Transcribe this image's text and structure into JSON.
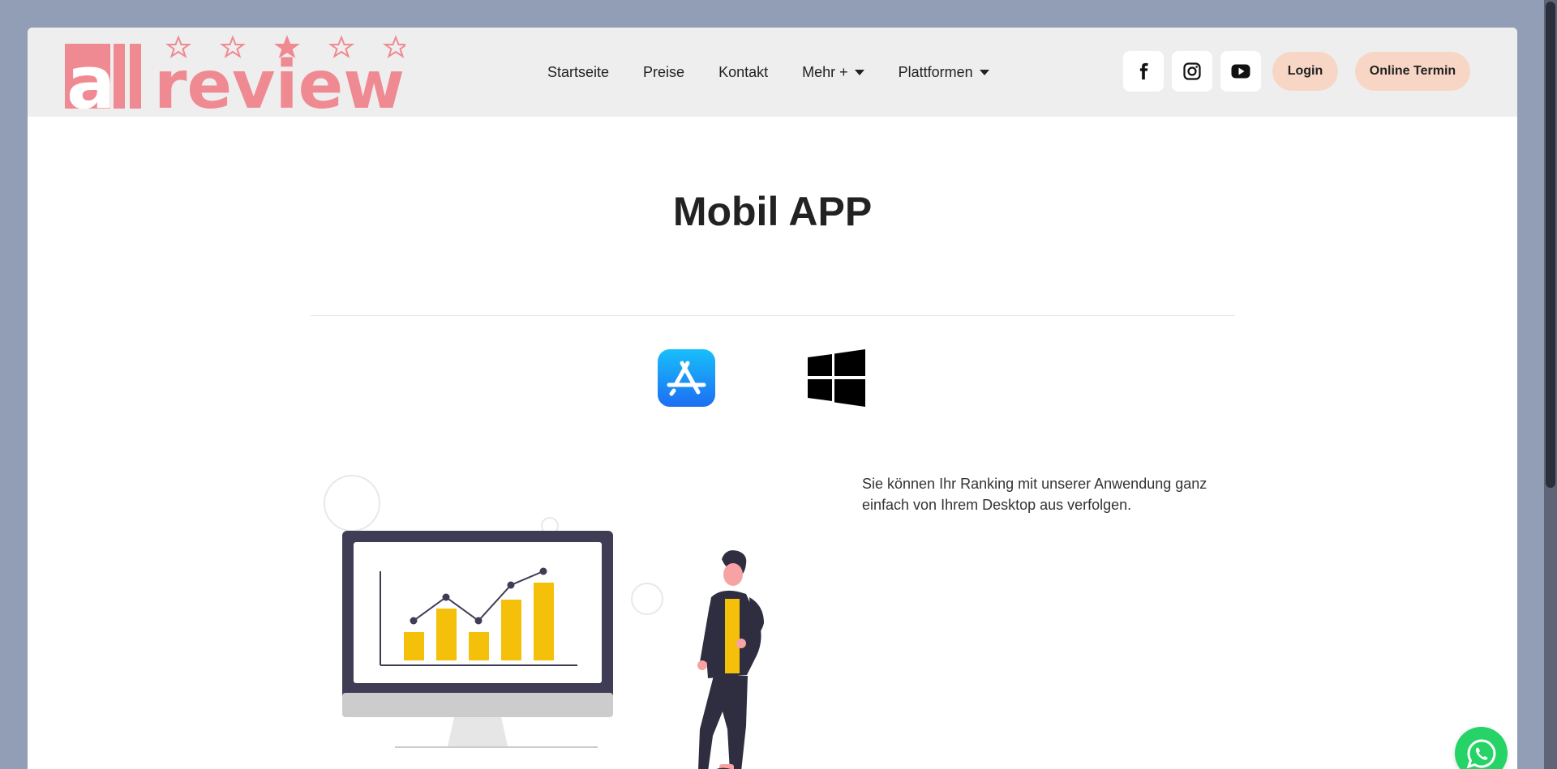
{
  "header": {
    "logo_text": "allreview",
    "nav": [
      {
        "label": "Startseite",
        "has_dropdown": false
      },
      {
        "label": "Preise",
        "has_dropdown": false
      },
      {
        "label": "Kontakt",
        "has_dropdown": false
      },
      {
        "label": "Mehr +",
        "has_dropdown": true
      },
      {
        "label": "Plattformen",
        "has_dropdown": true
      }
    ],
    "social": [
      {
        "icon": "facebook-icon"
      },
      {
        "icon": "instagram-icon"
      },
      {
        "icon": "youtube-icon"
      }
    ],
    "login_label": "Login",
    "appointment_label": "Online Termin"
  },
  "main": {
    "title": "Mobil APP",
    "stores": [
      {
        "icon": "app-store-icon"
      },
      {
        "icon": "windows-icon"
      }
    ],
    "description": "Sie können Ihr Ranking mit unserer Anwendung ganz einfach von Ihrem Desktop aus verfolgen."
  },
  "floating": {
    "icon": "whatsapp-icon"
  },
  "colors": {
    "page_background": "#919eb6",
    "header_background": "#eeeeee",
    "logo": "#f08a92",
    "pill_background": "#f8d6c5",
    "app_store_blue": "#1a8cf5",
    "chart_yellow": "#f5c009",
    "whatsapp_green": "#25d366"
  }
}
